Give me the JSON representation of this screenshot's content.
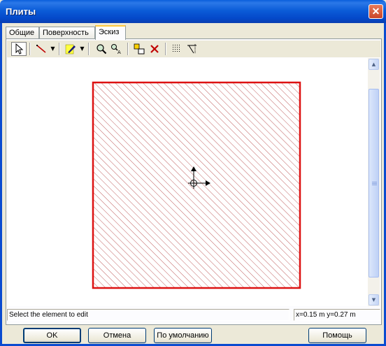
{
  "window": {
    "title": "Плиты",
    "close_glyph": "✕"
  },
  "tabs": [
    {
      "label": "Общие",
      "active": false
    },
    {
      "label": "Поверхность",
      "active": false
    },
    {
      "label": "Эскиз",
      "active": true
    }
  ],
  "toolbar": {
    "tools": [
      "select-arrow-icon",
      "line-tool-icon",
      "pencil-edit-icon",
      "zoom-icon",
      "zoom-all-icon",
      "move-element-icon",
      "delete-x-icon",
      "grid-icon",
      "snap-grid-icon"
    ],
    "zoom_all_label": "A",
    "dropdown_glyph": "▼"
  },
  "canvas": {
    "element": "slab-outline",
    "outline_color": "#dd1111",
    "hatch_color": "#c06060",
    "origin_marker": "crosshair-axes-icon"
  },
  "scrollbar": {
    "up_glyph": "▲",
    "down_glyph": "▼"
  },
  "status": {
    "message": "Select the element to edit",
    "coords": "x=0.15 m  y=0.27 m"
  },
  "buttons": {
    "ok": "OK",
    "cancel": "Отмена",
    "default": "По умолчанию",
    "help": "Помощь"
  }
}
